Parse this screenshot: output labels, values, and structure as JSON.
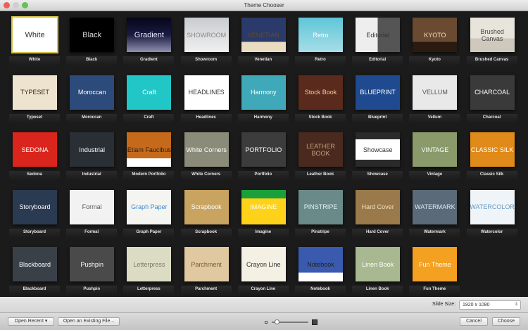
{
  "window": {
    "title": "Theme Chooser"
  },
  "themes": [
    {
      "name": "White",
      "thumb": "White",
      "bg": "#ffffff",
      "fg": "#333333",
      "selected": true
    },
    {
      "name": "Black",
      "thumb": "Black",
      "bg": "#000000",
      "fg": "#dddddd"
    },
    {
      "name": "Gradient",
      "thumb": "Gradient",
      "bg": "linear-gradient(#05051a,#1a1a40 50%,#9090b0)",
      "fg": "#e8e8ff"
    },
    {
      "name": "Showroom",
      "thumb": "SHOWROOM",
      "bg": "linear-gradient(#c8ccd0,#f0f0f0)",
      "fg": "#888888"
    },
    {
      "name": "Venetian",
      "thumb": "VENETIAN",
      "bg": "linear-gradient(#2a3a6a 70%,#e9dcc0 70%)",
      "fg": "#6a4a20"
    },
    {
      "name": "Retro",
      "thumb": "Retro",
      "bg": "linear-gradient(#5fc6d8,#a7dde8)",
      "fg": "#ffffff"
    },
    {
      "name": "Editorial",
      "thumb": "Editorial",
      "bg": "linear-gradient(90deg,#eeeeee 50%,#555 50%)",
      "fg": "#333333"
    },
    {
      "name": "Kyoto",
      "thumb": "KYOTO",
      "bg": "linear-gradient(#6a4a30 70%,#2a1a10 70%)",
      "fg": "#f0e0c0"
    },
    {
      "name": "Brushed Canvas",
      "thumb": "Brushed Canvas",
      "bg": "linear-gradient(#e7e4dc 60%,#cfc9bd 60%)",
      "fg": "#444444"
    },
    {
      "name": "Typeset",
      "thumb": "TYPESET",
      "bg": "#ede3cf",
      "fg": "#3a2a1a"
    },
    {
      "name": "Moroccan",
      "thumb": "Moroccan",
      "bg": "#2c4a7a",
      "fg": "#ffffff"
    },
    {
      "name": "Craft",
      "thumb": "Craft",
      "bg": "#21c7c7",
      "fg": "#ffffff"
    },
    {
      "name": "Headlines",
      "thumb": "HEADLINES",
      "bg": "#ffffff",
      "fg": "#333333"
    },
    {
      "name": "Harmony",
      "thumb": "Harmony",
      "bg": "#3fa9b9",
      "fg": "#ffffff"
    },
    {
      "name": "Stock Book",
      "thumb": "Stock Book",
      "bg": "#5a2a1c",
      "fg": "#f0d0a0"
    },
    {
      "name": "Blueprint",
      "thumb": "BLUEPRINT",
      "bg": "#1f4a8f",
      "fg": "#ffffff"
    },
    {
      "name": "Vellum",
      "thumb": "VELLUM",
      "bg": "#e9e9e9",
      "fg": "#555555"
    },
    {
      "name": "Charcoal",
      "thumb": "CHARCOAL",
      "bg": "#3a3a3a",
      "fg": "#ffffff"
    },
    {
      "name": "Sedona",
      "thumb": "SEDONA",
      "bg": "#d9251c",
      "fg": "#ffffff"
    },
    {
      "name": "Industrial",
      "thumb": "Industrial",
      "bg": "#2a2f36",
      "fg": "#ffffff"
    },
    {
      "name": "Modern Portfolio",
      "thumb": "Etiam Faucibus",
      "bg": "linear-gradient(#c56a1a 75%,#ffffff 75%)",
      "fg": "#222222"
    },
    {
      "name": "White Corners",
      "thumb": "White Corners",
      "bg": "#8b8b7a",
      "fg": "#ffffff"
    },
    {
      "name": "Portfolio",
      "thumb": "PORTFOLIO",
      "bg": "#3c3c3c",
      "fg": "#ffffff"
    },
    {
      "name": "Leather Book",
      "thumb": "LEATHER BOOK",
      "bg": "#4a2a1e",
      "fg": "#c8a080"
    },
    {
      "name": "Showcase",
      "thumb": "Showcase",
      "bg": "linear-gradient(#2a2a2a 20%,#ffffff 20%,#ffffff 80%,#2a2a2a 80%)",
      "fg": "#333333"
    },
    {
      "name": "Vintage",
      "thumb": "VINTAGE",
      "bg": "#8a9a6a",
      "fg": "#ffffff"
    },
    {
      "name": "Classic Silk",
      "thumb": "CLASSIC SILK",
      "bg": "#e08a1a",
      "fg": "#ffffff"
    },
    {
      "name": "Storyboard",
      "thumb": "Storyboard",
      "bg": "#2a3a50",
      "fg": "#ffffff"
    },
    {
      "name": "Formal",
      "thumb": "Formal",
      "bg": "#f2f2f2",
      "fg": "#555555"
    },
    {
      "name": "Graph Paper",
      "thumb": "Graph Paper",
      "bg": "#f4f4f0",
      "fg": "#3a8ad0"
    },
    {
      "name": "Scrapbook",
      "thumb": "Scrapbook",
      "bg": "#c8a460",
      "fg": "#ffffff"
    },
    {
      "name": "Imagine",
      "thumb": "IMAGINE",
      "bg": "linear-gradient(#1aa03a 25%,#ffd21a 25%)",
      "fg": "#ffffff"
    },
    {
      "name": "Pinstripe",
      "thumb": "PINSTRIPE",
      "bg": "#6a8a8a",
      "fg": "#e0f0f0"
    },
    {
      "name": "Hard Cover",
      "thumb": "Hard Cover",
      "bg": "#9a7a4a",
      "fg": "#f0e0c0"
    },
    {
      "name": "Watermark",
      "thumb": "WATERMARK",
      "bg": "#5a6a78",
      "fg": "#e0e8f0"
    },
    {
      "name": "Watercolor",
      "thumb": "WATERCOLOR",
      "bg": "#eef4f8",
      "fg": "#6a9ac0"
    },
    {
      "name": "Blackboard",
      "thumb": "Blackboard",
      "bg": "#3a4048",
      "fg": "#ffffff"
    },
    {
      "name": "Pushpin",
      "thumb": "Pushpin",
      "bg": "#4a4a4a",
      "fg": "#ffffff"
    },
    {
      "name": "Letterpress",
      "thumb": "Letterpress",
      "bg": "#dcdcc4",
      "fg": "#7a7a6a"
    },
    {
      "name": "Parchment",
      "thumb": "Parchment",
      "bg": "#e0c8a0",
      "fg": "#7a5a3a"
    },
    {
      "name": "Crayon Line",
      "thumb": "Crayon Line",
      "bg": "#f4f0e4",
      "fg": "#333333"
    },
    {
      "name": "Notebook",
      "thumb": "Notebook",
      "bg": "linear-gradient(#3a5ab0 75%,#ffffff 75%)",
      "fg": "#222222"
    },
    {
      "name": "Linen Book",
      "thumb": "Linen Book",
      "bg": "#a8b890",
      "fg": "#ffffff"
    },
    {
      "name": "Fun Theme",
      "thumb": "Fun Theme",
      "bg": "#f4a020",
      "fg": "#ffffff"
    }
  ],
  "slide_size": {
    "label": "Slide Size:",
    "value": "1920 x 1080",
    "arrow": "⇕"
  },
  "footer": {
    "open_recent": "Open Recent ▾",
    "open_existing": "Open an Existing File...",
    "cancel": "Cancel",
    "choose": "Choose"
  }
}
